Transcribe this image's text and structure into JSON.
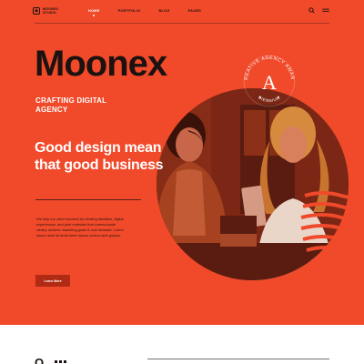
{
  "brand": {
    "logo_text": "MOONEX STUDIO",
    "logo_icon": "shield-icon",
    "name": "Moonex"
  },
  "nav": {
    "items": [
      {
        "label": "HOME",
        "active": true
      },
      {
        "label": "PORTFOLIO",
        "active": false
      },
      {
        "label": "BLOG",
        "active": false
      },
      {
        "label": "PAGES",
        "active": false
      }
    ],
    "icons": [
      "search-icon",
      "menu-icon"
    ]
  },
  "hero": {
    "tagline": "CRAFTING DIGITAL AGENCY",
    "headline": "Good design mean that good business",
    "body": "We help our client succeed by creating identities, digital experiences, and print materials that communicate clearly, achieve marketing goals & look fantastic. Lorem ipsum dolor sit amet lorem ipsum contra carfe gulpuls.",
    "cta_label": "Learn More"
  },
  "badge": {
    "text_top": "CREATIVE AGENCY AWARD",
    "letter": "A",
    "text_bottom": "BIENNIUM"
  },
  "bottom": {
    "title": "O"
  },
  "colors": {
    "hero_bg": "#f04a2a",
    "dark": "#1c1210",
    "cta_bg": "#b02a14",
    "white": "#ffffff"
  }
}
